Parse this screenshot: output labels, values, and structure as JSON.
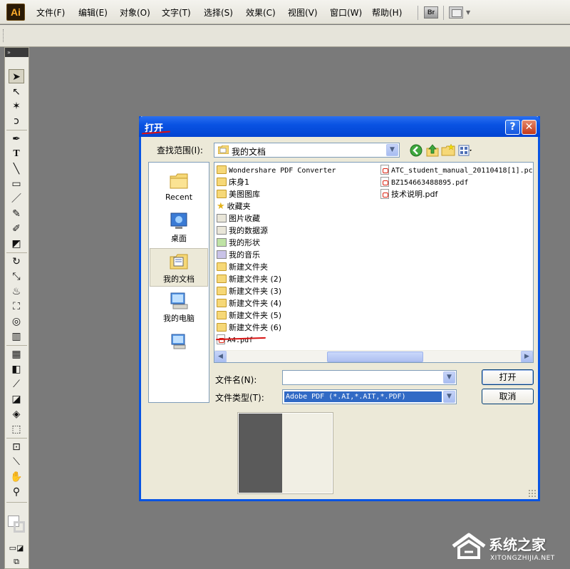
{
  "app": {
    "logo": "Ai",
    "menu": [
      "文件(F)",
      "编辑(E)",
      "对象(O)",
      "文字(T)",
      "选择(S)",
      "效果(C)",
      "视图(V)",
      "窗口(W)",
      "帮助(H)"
    ],
    "bridge_label": "Br"
  },
  "tools_header": "»",
  "dialog": {
    "title": "打开",
    "help_label": "?",
    "close_label": "✕",
    "lookin_label": "查找范围(I):",
    "lookin_value": "我的文档",
    "places": [
      "Recent",
      "桌面",
      "我的文档",
      "我的电脑"
    ],
    "files_col1": [
      {
        "name": "Wondershare PDF Converter",
        "type": "folder"
      },
      {
        "name": "床身1",
        "type": "folder"
      },
      {
        "name": "美图图库",
        "type": "folder"
      },
      {
        "name": "收藏夹",
        "type": "favorites"
      },
      {
        "name": "图片收藏",
        "type": "special"
      },
      {
        "name": "我的数据源",
        "type": "special"
      },
      {
        "name": "我的形状",
        "type": "special"
      },
      {
        "name": "我的音乐",
        "type": "special"
      },
      {
        "name": "新建文件夹",
        "type": "folder"
      },
      {
        "name": "新建文件夹 (2)",
        "type": "folder"
      },
      {
        "name": "新建文件夹 (3)",
        "type": "folder"
      },
      {
        "name": "新建文件夹 (4)",
        "type": "folder"
      },
      {
        "name": "新建文件夹 (5)",
        "type": "folder"
      },
      {
        "name": "新建文件夹 (6)",
        "type": "folder"
      },
      {
        "name": "A4.pdf",
        "type": "pdf"
      }
    ],
    "files_col2": [
      {
        "name": "ATC_student_manual_20110418[1].pc",
        "type": "pdf"
      },
      {
        "name": "BZ154663488895.pdf",
        "type": "pdf"
      },
      {
        "name": "技术说明.pdf",
        "type": "pdf"
      }
    ],
    "filename_label": "文件名(N):",
    "filename_value": "",
    "filetype_label": "文件类型(T):",
    "filetype_value": "Adobe PDF (*.AI,*.AIT,*.PDF)",
    "open_button": "打开",
    "cancel_button": "取消"
  },
  "watermark": {
    "name": "系统之家",
    "url": "XITONGZHIJIA.NET"
  },
  "colors": {
    "title_blue": "#0a53e3",
    "canvas_gray": "#7a7a7a",
    "annotation_red": "#d81414",
    "selection_blue": "#316ac5"
  }
}
